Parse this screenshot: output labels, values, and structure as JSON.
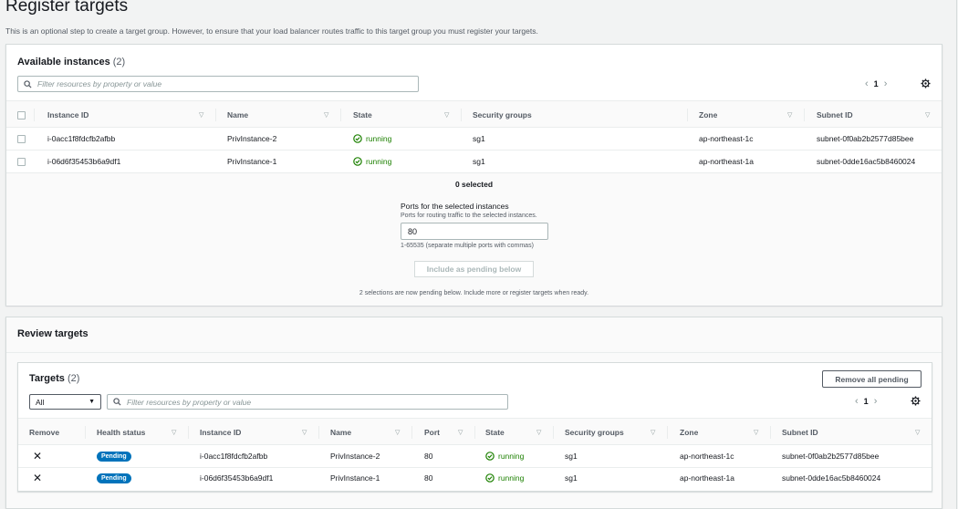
{
  "page": {
    "title": "Register targets",
    "description": "This is an optional step to create a target group. However, to ensure that your load balancer routes traffic to this target group you must register your targets."
  },
  "available": {
    "title": "Available instances",
    "count": "(2)",
    "search_placeholder": "Filter resources by property or value",
    "page_number": "1",
    "columns": [
      "Instance ID",
      "Name",
      "State",
      "Security groups",
      "Zone",
      "Subnet ID"
    ],
    "rows": [
      {
        "id": "i-0acc1f8fdcfb2afbb",
        "name": "PrivInstance-2",
        "state": "running",
        "sg": "sg1",
        "zone": "ap-northeast-1c",
        "subnet": "subnet-0f0ab2b2577d85bee"
      },
      {
        "id": "i-06d6f35453b6a9df1",
        "name": "PrivInstance-1",
        "state": "running",
        "sg": "sg1",
        "zone": "ap-northeast-1a",
        "subnet": "subnet-0dde16ac5b8460024"
      }
    ],
    "selected_text": "0 selected",
    "ports_label": "Ports for the selected instances",
    "ports_desc": "Ports for routing traffic to the selected instances.",
    "port_value": "80",
    "ports_hint": "1-65535 (separate multiple ports with commas)",
    "include_button": "Include as pending below",
    "pending_note": "2 selections are now pending below. Include more or register targets when ready."
  },
  "review": {
    "title": "Review targets",
    "targets_title": "Targets",
    "targets_count": "(2)",
    "remove_all_button": "Remove all pending",
    "filter_select": "All",
    "search_placeholder": "Filter resources by property or value",
    "page_number": "1",
    "columns": [
      "Remove",
      "Health status",
      "Instance ID",
      "Name",
      "Port",
      "State",
      "Security groups",
      "Zone",
      "Subnet ID"
    ],
    "rows": [
      {
        "health": "Pending",
        "id": "i-0acc1f8fdcfb2afbb",
        "name": "PrivInstance-2",
        "port": "80",
        "state": "running",
        "sg": "sg1",
        "zone": "ap-northeast-1c",
        "subnet": "subnet-0f0ab2b2577d85bee"
      },
      {
        "health": "Pending",
        "id": "i-06d6f35453b6a9df1",
        "name": "PrivInstance-1",
        "port": "80",
        "state": "running",
        "sg": "sg1",
        "zone": "ap-northeast-1a",
        "subnet": "subnet-0dde16ac5b8460024"
      }
    ]
  },
  "icons": {
    "search": "search-icon",
    "gear": "gear-icon",
    "running": "check-circle-icon",
    "remove": "close-icon",
    "sort": "caret-down-icon"
  },
  "colors": {
    "running": "#1d8102",
    "pending_badge": "#0073bb",
    "background": "#f2f3f3"
  }
}
